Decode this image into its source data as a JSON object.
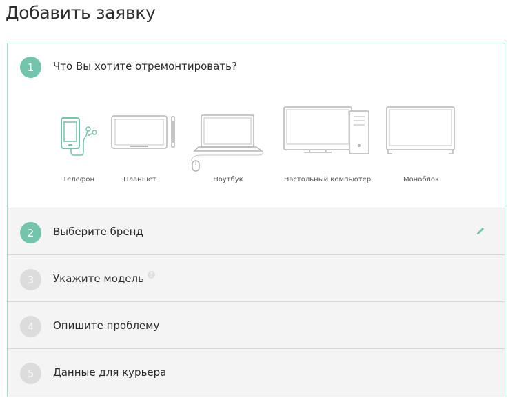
{
  "page": {
    "title": "Добавить заявку"
  },
  "steps": [
    {
      "number": "1",
      "label": "Что Вы хотите отремонтировать?"
    },
    {
      "number": "2",
      "label": "Выберите бренд"
    },
    {
      "number": "3",
      "label": "Укажите модель",
      "help": "?"
    },
    {
      "number": "4",
      "label": "Опишите проблему"
    },
    {
      "number": "5",
      "label": "Данные для курьера"
    }
  ],
  "devices": [
    {
      "label": "Телефон",
      "icon": "phone-icon"
    },
    {
      "label": "Планшет",
      "icon": "tablet-icon"
    },
    {
      "label": "Ноутбук",
      "icon": "laptop-icon"
    },
    {
      "label": "Настольный компьютер",
      "icon": "desktop-icon"
    },
    {
      "label": "Моноблок",
      "icon": "all-in-one-icon"
    }
  ],
  "colors": {
    "accent": "#72c4ac",
    "border": "#a9d8cc",
    "inactive_step": "#dcdcdc",
    "row_background": "#f4f4f4"
  }
}
